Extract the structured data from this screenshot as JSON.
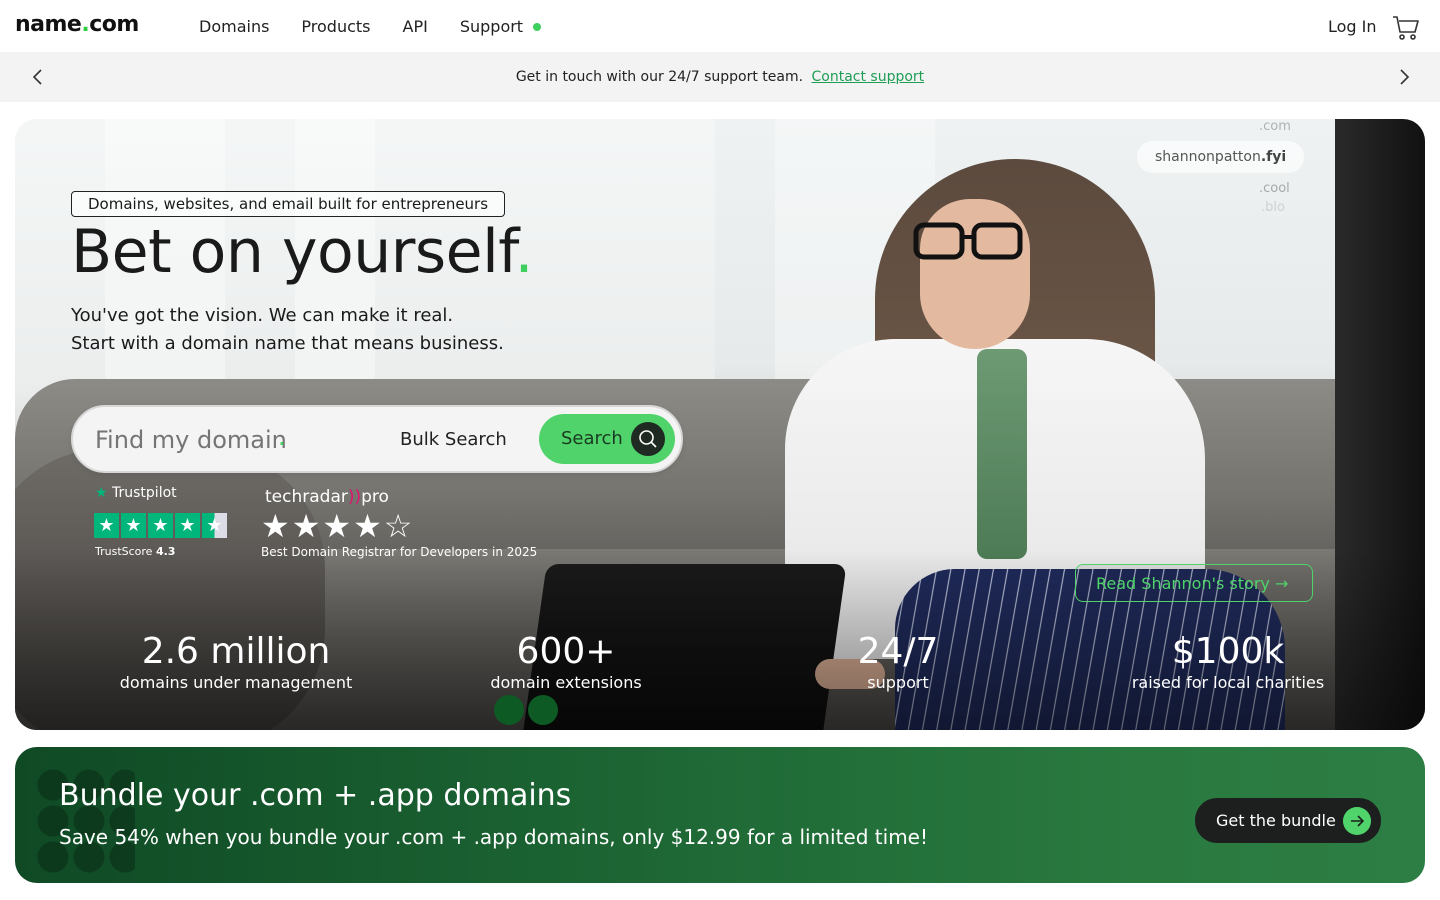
{
  "nav": {
    "logo_main": "name",
    "logo_dot": ".",
    "logo_tld": "com",
    "links": [
      "Domains",
      "Products",
      "API",
      "Support"
    ],
    "support_status_color": "#3ecf5e",
    "login": "Log In",
    "cart_icon": "cart-icon"
  },
  "announcement": {
    "text": "Get in touch with our 24/7 support team.",
    "link": "Contact support",
    "prev_icon": "chevron-left-icon",
    "next_icon": "chevron-right-icon"
  },
  "hero": {
    "tagline": "Domains, websites, and email built for entrepreneurs",
    "headline": "Bet on yourself",
    "headline_accent": ".",
    "subline_1": "You've got the vision. We can make it real.",
    "subline_2": "Start with a domain name that means business.",
    "search": {
      "placeholder": "Find my domain",
      "placeholder_accent": ".",
      "bulk_label": "Bulk Search",
      "button_label": "Search"
    },
    "floating_domains": {
      "tld_top": ".com",
      "pill_name": "shannonpatton",
      "pill_tld": ".fyi",
      "tld_mid": ".cool",
      "tld_bottom": ".blo"
    },
    "trustpilot": {
      "brand": "Trustpilot",
      "score_label": "TrustScore",
      "score": "4.3",
      "stars_shown": 4.5
    },
    "techradar": {
      "brand": "techradar",
      "brand_suffix": "pro",
      "stars": "★★★★☆",
      "caption": "Best Domain Registrar for Developers in 2025"
    },
    "story_button": "Read Shannon's story →",
    "stats": [
      {
        "value": "2.6 million",
        "label": "domains under management"
      },
      {
        "value": "600+",
        "label": "domain extensions"
      },
      {
        "value": "24/7",
        "label": "support"
      },
      {
        "value": "$100k",
        "label": "raised for local charities"
      }
    ]
  },
  "promo": {
    "title": "Bundle your .com + .app domains",
    "subtitle": "Save 54% when you bundle your .com + .app domains, only $12.99 for a limited time!",
    "button_label": "Get the bundle"
  },
  "colors": {
    "brand_green": "#3ecf5e",
    "link_green": "#1f9d55",
    "promo_bg": "#1f6a36",
    "trustpilot_green": "#00b67a"
  }
}
